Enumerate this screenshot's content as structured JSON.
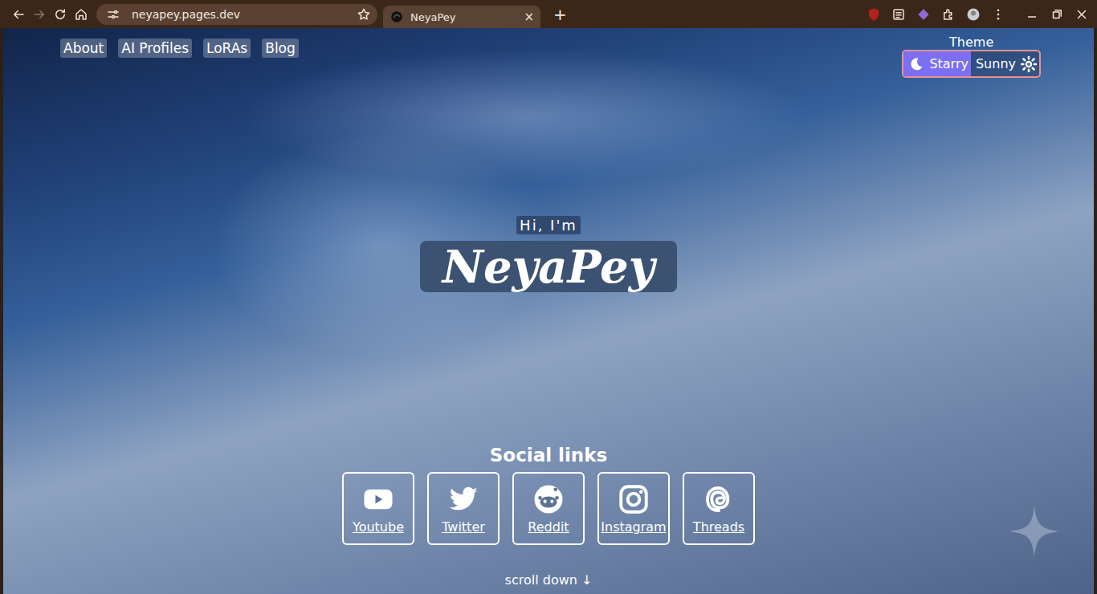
{
  "browser": {
    "address": "neyapey.pages.dev",
    "tab": {
      "title": "NeyaPey",
      "selected": true
    },
    "close": "×",
    "new_tab": "+"
  },
  "nav": [
    {
      "label": "About"
    },
    {
      "label": "AI Profiles"
    },
    {
      "label": "LoRAs"
    },
    {
      "label": "Blog"
    }
  ],
  "theme": {
    "label": "Theme",
    "options": [
      {
        "label": "Starry",
        "selected": true,
        "kind": "moon"
      },
      {
        "label": "Sunny",
        "selected": false,
        "kind": "sun"
      }
    ]
  },
  "hero": {
    "greeting": "Hi, I'm",
    "name": "NeyaPey"
  },
  "social": {
    "title": "Social links",
    "links": [
      {
        "label": "Youtube",
        "kind": "youtube"
      },
      {
        "label": "Twitter",
        "kind": "twitter"
      },
      {
        "label": "Reddit",
        "kind": "reddit"
      },
      {
        "label": "Instagram",
        "kind": "instagram"
      },
      {
        "label": "Threads",
        "kind": "threads"
      }
    ]
  },
  "scroll_hint": "scroll down ↓"
}
